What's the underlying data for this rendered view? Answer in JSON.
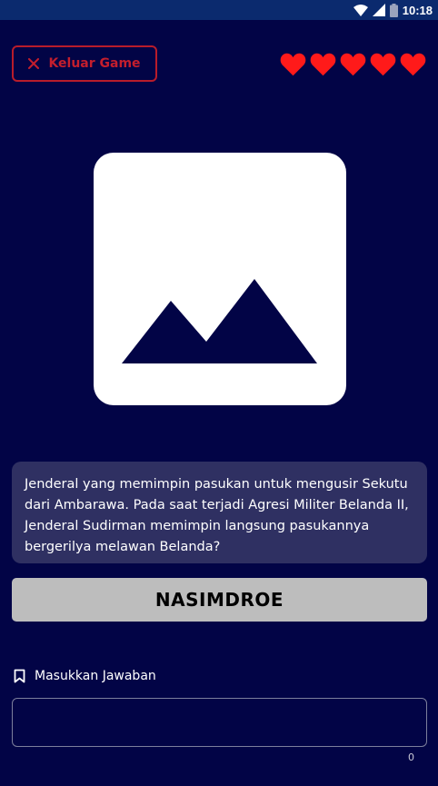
{
  "status_bar": {
    "time": "10:18",
    "icons": [
      "wifi-icon",
      "signal-icon",
      "battery-icon"
    ],
    "background": "#0b2a6e"
  },
  "header": {
    "exit_label": "Keluar Game",
    "exit_icon": "close-icon",
    "exit_color": "#c41e2d",
    "lives": 5,
    "heart_color": "#ff1a1a"
  },
  "question": {
    "image_icon": "image-placeholder-icon",
    "text": "Jenderal yang memimpin pasukan untuk mengusir Sekutu dari Ambarawa. Pada saat terjadi Agresi Militer Belanda II, Jenderal Sudirman memimpin langsung pasukannya bergerilya melawan Belanda?"
  },
  "scrambled_word": "NASIMDROE",
  "answer": {
    "label": "Masukkan Jawaban",
    "label_icon": "bookmark-icon",
    "value": "",
    "char_count": "0"
  }
}
